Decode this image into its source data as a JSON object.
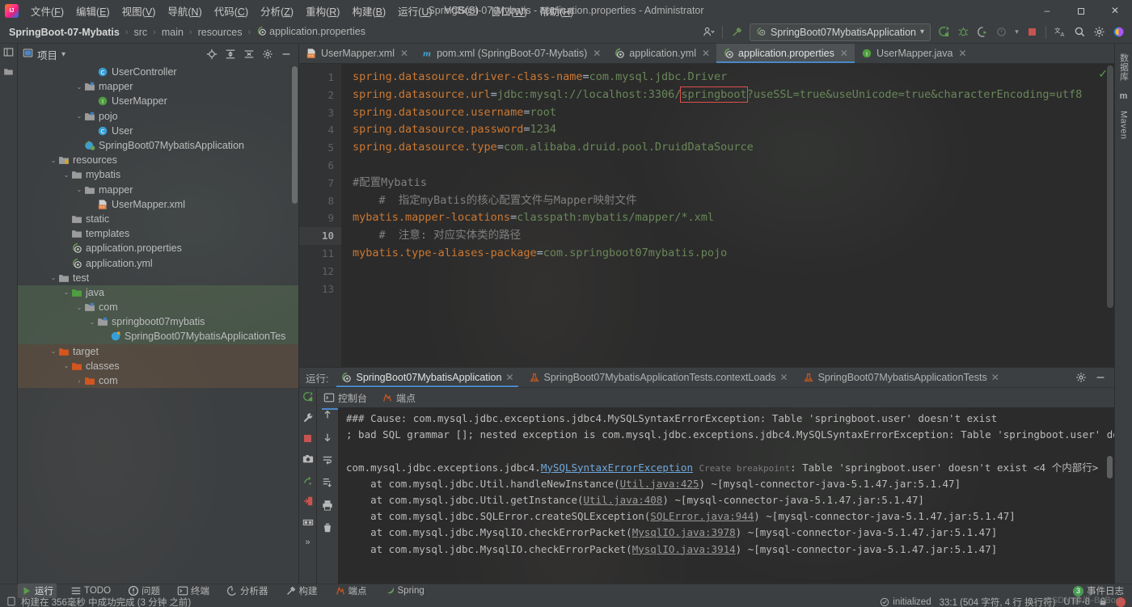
{
  "window": {
    "title": "SpringBoot-07-Mybatis - application.properties - Administrator",
    "minimize": "–",
    "maximize": "❐",
    "close": "✕"
  },
  "menubar": [
    {
      "label": "文件(F)"
    },
    {
      "label": "编辑(E)"
    },
    {
      "label": "视图(V)"
    },
    {
      "label": "导航(N)"
    },
    {
      "label": "代码(C)"
    },
    {
      "label": "分析(Z)"
    },
    {
      "label": "重构(R)"
    },
    {
      "label": "构建(B)"
    },
    {
      "label": "运行(U)"
    },
    {
      "label": "VCS(S)"
    },
    {
      "label": "窗口(W)"
    },
    {
      "label": "帮助(H)"
    }
  ],
  "breadcrumb": {
    "items": [
      "SpringBoot-07-Mybatis",
      "src",
      "main",
      "resources",
      "application.properties"
    ],
    "separator": "›"
  },
  "toolbar": {
    "run_config": "SpringBoot07MybatisApplication",
    "dropdown_caret": "▾",
    "icons": [
      "user-settings-icon",
      "update-project-icon",
      "run-icon",
      "debug-icon",
      "run-with-coverage-icon",
      "profile-icon",
      "stop-icon",
      "translate-icon",
      "search-everywhere-icon",
      "settings-icon",
      "ide-help-icon"
    ]
  },
  "project_panel": {
    "title": "项目",
    "dropdown_caret": "▾",
    "tools": [
      "locate-icon",
      "expand-all-icon",
      "collapse-all-icon",
      "gear-icon",
      "hide-icon"
    ],
    "tree": [
      {
        "indent": 5,
        "icon": "class-icon",
        "label": "UserController",
        "band": "none",
        "arrow": ""
      },
      {
        "indent": 4,
        "icon": "folder-package-icon",
        "label": "mapper",
        "band": "none",
        "arrow": "⌄"
      },
      {
        "indent": 5,
        "icon": "interface-icon",
        "label": "UserMapper",
        "band": "none",
        "arrow": ""
      },
      {
        "indent": 4,
        "icon": "folder-package-icon",
        "label": "pojo",
        "band": "none",
        "arrow": "⌄"
      },
      {
        "indent": 5,
        "icon": "class-icon",
        "label": "User",
        "band": "none",
        "arrow": ""
      },
      {
        "indent": 4,
        "icon": "spring-class-icon",
        "label": "SpringBoot07MybatisApplication",
        "band": "none",
        "arrow": ""
      },
      {
        "indent": 2,
        "icon": "resources-folder-icon",
        "label": "resources",
        "band": "none",
        "arrow": "⌄"
      },
      {
        "indent": 3,
        "icon": "folder-icon",
        "label": "mybatis",
        "band": "none",
        "arrow": "⌄"
      },
      {
        "indent": 4,
        "icon": "folder-icon",
        "label": "mapper",
        "band": "none",
        "arrow": "⌄"
      },
      {
        "indent": 5,
        "icon": "xml-icon",
        "label": "UserMapper.xml",
        "band": "none",
        "arrow": ""
      },
      {
        "indent": 3,
        "icon": "folder-icon",
        "label": "static",
        "band": "none",
        "arrow": ""
      },
      {
        "indent": 3,
        "icon": "folder-icon",
        "label": "templates",
        "band": "none",
        "arrow": ""
      },
      {
        "indent": 3,
        "icon": "spring-config-icon",
        "label": "application.properties",
        "band": "none",
        "arrow": ""
      },
      {
        "indent": 3,
        "icon": "spring-config-icon",
        "label": "application.yml",
        "band": "none",
        "arrow": ""
      },
      {
        "indent": 2,
        "icon": "folder-icon",
        "label": "test",
        "band": "none",
        "arrow": "⌄"
      },
      {
        "indent": 3,
        "icon": "test-source-folder-icon",
        "label": "java",
        "band": "green",
        "arrow": "⌄"
      },
      {
        "indent": 4,
        "icon": "folder-package-icon",
        "label": "com",
        "band": "green",
        "arrow": "⌄"
      },
      {
        "indent": 5,
        "icon": "folder-package-icon",
        "label": "springboot07mybatis",
        "band": "green",
        "arrow": "⌄"
      },
      {
        "indent": 6,
        "icon": "test-class-icon",
        "label": "SpringBoot07MybatisApplicationTes",
        "band": "green",
        "arrow": ""
      },
      {
        "indent": 2,
        "icon": "target-folder-icon",
        "label": "target",
        "band": "orange",
        "arrow": "⌄"
      },
      {
        "indent": 3,
        "icon": "target-folder-icon",
        "label": "classes",
        "band": "orange",
        "arrow": "⌄"
      },
      {
        "indent": 4,
        "icon": "target-folder-icon",
        "label": "com",
        "band": "orange",
        "arrow": "›"
      }
    ]
  },
  "editor": {
    "tabs": [
      {
        "label": "UserMapper.xml",
        "icon": "xml-icon",
        "active": false,
        "close": "✕"
      },
      {
        "label": "pom.xml (SpringBoot-07-Mybatis)",
        "icon": "maven-icon",
        "active": false,
        "close": "✕"
      },
      {
        "label": "application.yml",
        "icon": "spring-config-icon",
        "active": false,
        "close": "✕"
      },
      {
        "label": "application.properties",
        "icon": "spring-config-icon",
        "active": true,
        "close": "✕"
      },
      {
        "label": "UserMapper.java",
        "icon": "interface-icon",
        "active": false,
        "close": "✕"
      }
    ],
    "current_line": 10,
    "inspection_status": "✓",
    "lines": [
      {
        "no": 1,
        "type": "prop",
        "key": "spring.datasource.driver-class-name",
        "value": "com.mysql.jdbc.Driver"
      },
      {
        "no": 2,
        "type": "prop-highlight",
        "key": "spring.datasource.url",
        "pre": "jdbc:mysql://localhost:3306/",
        "boxed": "springboot",
        "post": "?useSSL=true&useUnicode=true&characterEncoding=utf8"
      },
      {
        "no": 3,
        "type": "prop",
        "key": "spring.datasource.username",
        "value": "root"
      },
      {
        "no": 4,
        "type": "prop",
        "key": "spring.datasource.password",
        "value": "1234"
      },
      {
        "no": 5,
        "type": "prop",
        "key": "spring.datasource.type",
        "value": "com.alibaba.druid.pool.DruidDataSource"
      },
      {
        "no": 6,
        "type": "blank"
      },
      {
        "no": 7,
        "type": "comment",
        "text": "#配置Mybatis"
      },
      {
        "no": 8,
        "type": "comment",
        "text": "    #  指定myBatis的核心配置文件与Mapper映射文件"
      },
      {
        "no": 9,
        "type": "prop",
        "key": "mybatis.mapper-locations",
        "value": "classpath:mybatis/mapper/*.xml"
      },
      {
        "no": 10,
        "type": "comment",
        "text": "    #  注意: 对应实体类的路径"
      },
      {
        "no": 11,
        "type": "prop",
        "key": "mybatis.type-aliases-package",
        "value": "com.springboot07mybatis.pojo"
      },
      {
        "no": 12,
        "type": "blank"
      },
      {
        "no": 13,
        "type": "blank"
      }
    ]
  },
  "run_panel": {
    "label": "运行:",
    "tabs": [
      {
        "label": "SpringBoot07MybatisApplication",
        "icon": "spring-run-icon",
        "active": true,
        "close": "✕"
      },
      {
        "label": "SpringBoot07MybatisApplicationTests.contextLoads",
        "icon": "test-run-icon",
        "active": false,
        "close": "✕"
      },
      {
        "label": "SpringBoot07MybatisApplicationTests",
        "icon": "test-run-icon",
        "active": false,
        "close": "✕"
      }
    ],
    "right_icons": [
      "gear-icon",
      "hide-icon"
    ],
    "subtabs": [
      {
        "label": "控制台",
        "icon": "console-icon",
        "active": true
      },
      {
        "label": "端点",
        "icon": "endpoints-icon",
        "active": false
      }
    ],
    "gutter_icons": [
      "rerun-icon",
      "wrench-icon",
      "stop-icon",
      "screenshot-icon",
      "thread-dump-icon",
      "export-icon",
      "layout-icon",
      "more-icon"
    ],
    "gutter2_icons": [
      "console-toggle-icon",
      "scroll-up-icon",
      "scroll-down-icon",
      "soft-wrap-icon",
      "scroll-to-end-icon",
      "print-icon",
      "trash-icon"
    ],
    "console": [
      {
        "type": "plain",
        "text": "### Cause: com.mysql.jdbc.exceptions.jdbc4.MySQLSyntaxErrorException: Table 'springboot.user' doesn't exist"
      },
      {
        "type": "plain",
        "text": "; bad SQL grammar []; nested exception is com.mysql.jdbc.exceptions.jdbc4.MySQLSyntaxErrorException: Table 'springboot.user' doesn't exist] with root cause"
      },
      {
        "type": "blank",
        "text": ""
      },
      {
        "type": "selected",
        "pre": "com.mysql.jdbc.exceptions.jdbc4.",
        "link": "MySQLSyntaxErrorException",
        "hint": "Create breakpoint",
        "post": ": Table 'springboot.user' doesn't exist <4 个内部行>"
      },
      {
        "type": "trace",
        "pre": "    at com.mysql.jdbc.Util.handleNewInstance(",
        "link": "Util.java:425",
        "post": ") ~[mysql-connector-java-5.1.47.jar:5.1.47]"
      },
      {
        "type": "trace",
        "pre": "    at com.mysql.jdbc.Util.getInstance(",
        "link": "Util.java:408",
        "post": ") ~[mysql-connector-java-5.1.47.jar:5.1.47]"
      },
      {
        "type": "trace",
        "pre": "    at com.mysql.jdbc.SQLError.createSQLException(",
        "link": "SQLError.java:944",
        "post": ") ~[mysql-connector-java-5.1.47.jar:5.1.47]"
      },
      {
        "type": "trace",
        "pre": "    at com.mysql.jdbc.MysqlIO.checkErrorPacket(",
        "link": "MysqlIO.java:3978",
        "post": ") ~[mysql-connector-java-5.1.47.jar:5.1.47]"
      },
      {
        "type": "trace",
        "pre": "    at com.mysql.jdbc.MysqlIO.checkErrorPacket(",
        "link": "MysqlIO.java:3914",
        "post": ") ~[mysql-connector-java-5.1.47.jar:5.1.47]"
      }
    ]
  },
  "left_rail": {
    "top_icons": [
      "project-structure-icon",
      "folder-icon"
    ]
  },
  "right_rail": {
    "items": [
      "数据库",
      "Maven"
    ]
  },
  "status_bar": {
    "tools": [
      {
        "label": "运行",
        "icon": "run-icon",
        "active": true
      },
      {
        "label": "TODO",
        "icon": "todo-icon",
        "active": false
      },
      {
        "label": "问题",
        "icon": "problems-icon",
        "active": false
      },
      {
        "label": "终端",
        "icon": "terminal-icon",
        "active": false
      },
      {
        "label": "分析器",
        "icon": "profiler-icon",
        "active": false
      },
      {
        "label": "构建",
        "icon": "build-icon",
        "active": false
      },
      {
        "label": "端点",
        "icon": "endpoints-icon",
        "active": false
      },
      {
        "label": "Spring",
        "icon": "spring-icon",
        "active": false
      }
    ],
    "build_message": "构建在 356毫秒 中成功完成 (3 分钟 之前)",
    "event_log": "事件日志",
    "event_count": "3",
    "initialized": "initialized",
    "caret_position": "33:1 (504 字符, 4 行 换行符)",
    "encoding": "UTF-8",
    "watermark": "CSDN @半-BoBoo"
  },
  "colors": {
    "accent_blue": "#4a88c7",
    "error_red": "#e04f4f",
    "string_green": "#6a8759",
    "key_orange": "#cc7832",
    "selection_blue": "#2f5489"
  }
}
